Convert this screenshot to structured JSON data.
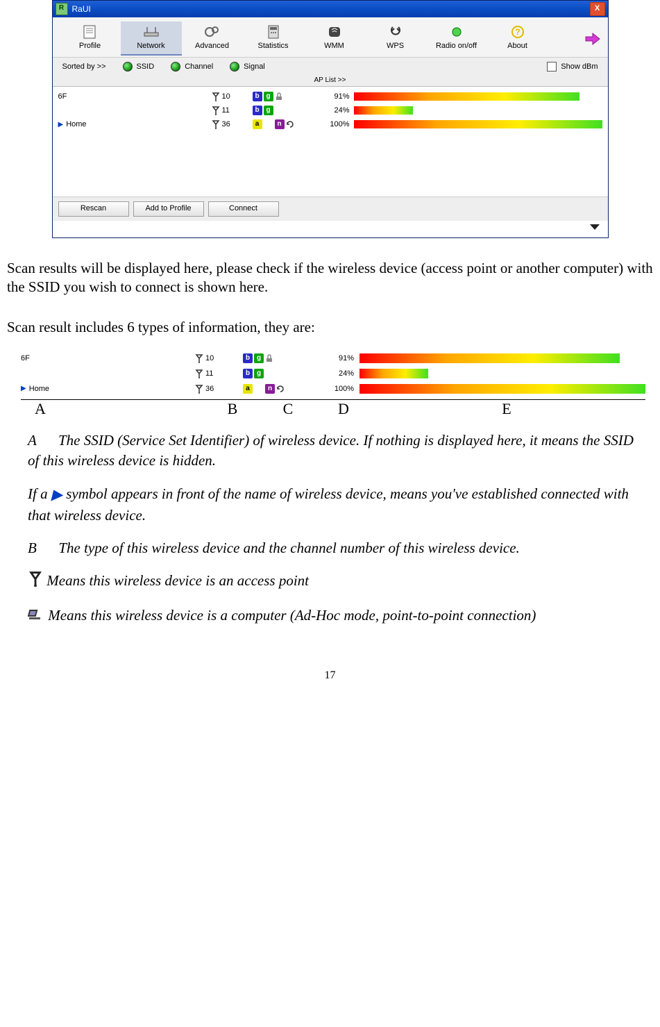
{
  "window": {
    "title": "RaUI",
    "close": "X"
  },
  "tabs": [
    {
      "label": "Profile"
    },
    {
      "label": "Network"
    },
    {
      "label": "Advanced"
    },
    {
      "label": "Statistics"
    },
    {
      "label": "WMM"
    },
    {
      "label": "WPS"
    },
    {
      "label": "Radio on/off"
    },
    {
      "label": "About"
    }
  ],
  "sort": {
    "label": "Sorted by >>",
    "ssid": "SSID",
    "channel": "Channel",
    "signal": "Signal",
    "showdbm": "Show dBm",
    "aplist": "AP List >>"
  },
  "networks": [
    {
      "name": "6F",
      "connected": false,
      "channel": "10",
      "modes": [
        "b",
        "g"
      ],
      "lock": true,
      "signal": "91%",
      "bar": 91
    },
    {
      "name": "",
      "connected": false,
      "channel": "11",
      "modes": [
        "b",
        "g"
      ],
      "lock": false,
      "signal": "24%",
      "bar": 24
    },
    {
      "name": "Home",
      "connected": true,
      "channel": "36",
      "modes": [
        "a",
        "n"
      ],
      "lock": false,
      "refresh": true,
      "signal": "100%",
      "bar": 100
    }
  ],
  "buttons": {
    "rescan": "Rescan",
    "add": "Add to Profile",
    "connect": "Connect"
  },
  "doc": {
    "p1": "Scan results will be displayed here, please check if the wireless device (access point or another computer) with the SSID you wish to connect is shown here.",
    "p2": "Scan result includes 6 types of information, they are:",
    "labels": {
      "a": "A",
      "b": "B",
      "c": "C",
      "d": "D",
      "e": "E"
    },
    "defA": "A      The SSID (Service Set Identifier) of wireless device. If nothing is displayed here, it means the SSID of this wireless device is hidden.",
    "defTri1": "If a",
    "defTri2": "symbol appears in front of the name of wireless device, means you've established connected with that wireless device.",
    "defB": "B      The type of this wireless device and the channel number of this wireless device.",
    "defAP": "Means this wireless device is an access point",
    "defPC": "Means this wireless device is a computer (Ad-Hoc mode, point-to-point connection)",
    "pageno": "17"
  }
}
